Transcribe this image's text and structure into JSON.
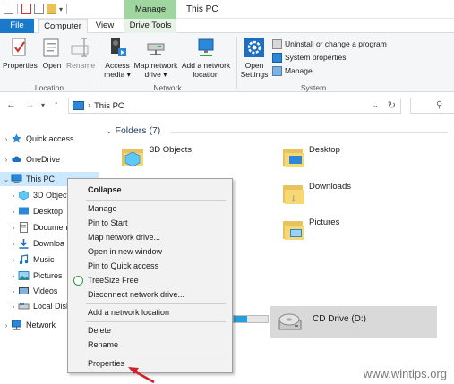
{
  "window": {
    "title": "This PC",
    "context_tab_group": "Manage"
  },
  "ribbon": {
    "tabs": [
      {
        "label": "File"
      },
      {
        "label": "Computer"
      },
      {
        "label": "View"
      },
      {
        "label": "Drive Tools"
      }
    ],
    "location_group": {
      "label": "Location",
      "buttons": [
        {
          "label": "Properties",
          "icon": "check-properties-icon"
        },
        {
          "label": "Open",
          "icon": "folder-open-icon"
        },
        {
          "label": "Rename",
          "icon": "rename-icon"
        }
      ]
    },
    "network_group": {
      "label": "Network",
      "buttons": [
        {
          "label_line1": "Access",
          "label_line2": "media ▾",
          "icon": "media-icon"
        },
        {
          "label_line1": "Map network",
          "label_line2": "drive ▾",
          "icon": "map-drive-icon"
        },
        {
          "label_line1": "Add a network",
          "label_line2": "location",
          "icon": "network-location-icon"
        }
      ]
    },
    "system_group": {
      "label": "System",
      "open_settings": {
        "label_line1": "Open",
        "label_line2": "Settings"
      },
      "items": [
        {
          "label": "Uninstall or change a program"
        },
        {
          "label": "System properties"
        },
        {
          "label": "Manage"
        }
      ]
    }
  },
  "address_bar": {
    "path": "This PC"
  },
  "nav_pane": {
    "items": [
      {
        "label": "Quick access"
      },
      {
        "label": "OneDrive"
      },
      {
        "label": "This PC"
      },
      {
        "label": "3D Object"
      },
      {
        "label": "Desktop"
      },
      {
        "label": "Documen"
      },
      {
        "label": "Downloa"
      },
      {
        "label": "Music"
      },
      {
        "label": "Pictures"
      },
      {
        "label": "Videos"
      },
      {
        "label": "Local Disk"
      },
      {
        "label": "Network"
      }
    ]
  },
  "content": {
    "folders_header": "Folders (7)",
    "folders": [
      {
        "label": "3D Objects"
      },
      {
        "label": "Desktop"
      },
      {
        "label": "Downloads"
      },
      {
        "label": "Pictures"
      }
    ],
    "cd_drive": {
      "label": "CD Drive (D:)"
    },
    "disk_usage_fraction": 0.4
  },
  "context_menu": {
    "items": [
      {
        "label": "Collapse"
      },
      {
        "label": "Manage"
      },
      {
        "label": "Pin to Start"
      },
      {
        "label": "Map network drive..."
      },
      {
        "label": "Open in new window"
      },
      {
        "label": "Pin to Quick access"
      },
      {
        "label": "TreeSize Free"
      },
      {
        "label": "Disconnect network drive..."
      },
      {
        "label": "Add a network location"
      },
      {
        "label": "Delete"
      },
      {
        "label": "Rename"
      },
      {
        "label": "Properties"
      }
    ]
  },
  "watermark": "www.wintips.org",
  "colors": {
    "file_tab": "#1979ca",
    "manage_context": "#9fd59f",
    "selection": "#cce8ff",
    "arrow": "#d0202a"
  }
}
